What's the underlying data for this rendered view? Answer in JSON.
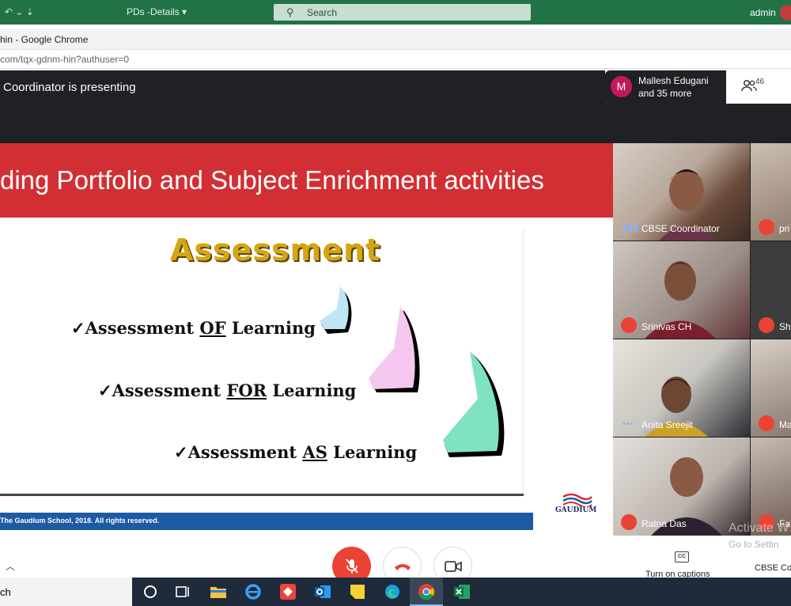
{
  "excel": {
    "doc_title": "PDs -Details",
    "search_placeholder": "Search",
    "user": "admin"
  },
  "chrome": {
    "window_title": "hin - Google Chrome",
    "url": "com/tqx-gdnm-hin?authuser=0"
  },
  "meet": {
    "presenting": "Coordinator is presenting",
    "people_card": {
      "avatar_letter": "M",
      "name_line1": "Mallesh Edugani",
      "name_line2": "and 35 more",
      "participant_count": "46"
    },
    "slide": {
      "banner_title": "ding Portfolio and Subject Enrichment activities",
      "heading": "Assessment",
      "items": [
        {
          "prefix": "✓Assessment ",
          "underline": "OF",
          "suffix": " Learning"
        },
        {
          "prefix": "✓Assessment ",
          "underline": "FOR",
          "suffix": " Learning"
        },
        {
          "prefix": "✓Assessment ",
          "underline": "AS",
          "suffix": " Learning"
        }
      ],
      "footer": "The Gaudium School, 2018. All rights reserved.",
      "logo_text": "GAUDIUM"
    },
    "tiles": [
      {
        "name": "CBSE Coordinator"
      },
      {
        "name": "pri"
      },
      {
        "name": "Srinivas CH"
      },
      {
        "name": "Sh"
      },
      {
        "name": "Anita Sreejit"
      },
      {
        "name": "Ma"
      },
      {
        "name": "Ratna Das"
      },
      {
        "name": "Fat"
      }
    ],
    "captions_label": "Turn on captions",
    "presenter_label": "CBSE Co",
    "watermark_line1": "Activate W",
    "watermark_line2": "Go to Settin"
  },
  "taskbar": {
    "search_text": "ch"
  },
  "colors": {
    "excel_green": "#217346",
    "meet_bg": "#202124",
    "banner_red": "#d22f34",
    "heading_gold": "#d7a413",
    "footer_blue": "#1d5aa4",
    "mic_red": "#ea4335"
  }
}
